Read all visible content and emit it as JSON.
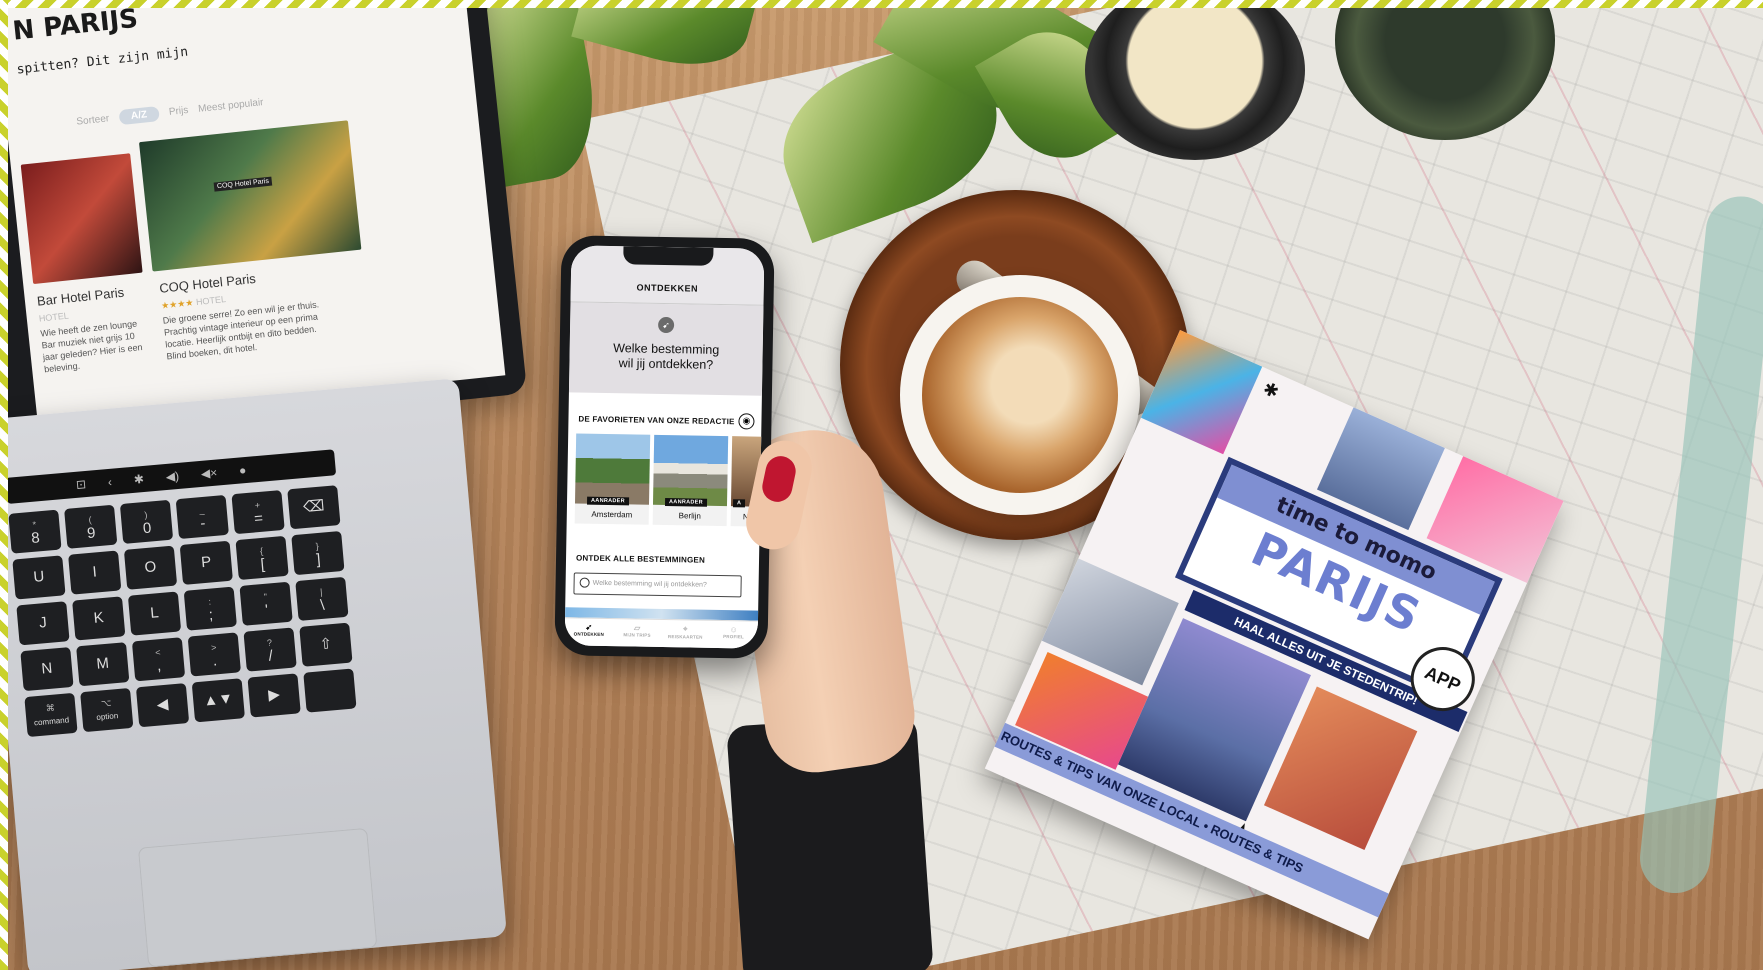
{
  "website": {
    "title": "N PARIJS",
    "subtitle": "spitten? Dit zijn mijn",
    "sort_label": "Sorteer",
    "sort_active": "A/Z",
    "sort_option_2": "Prijs",
    "sort_option_3": "Meest populair",
    "cards": [
      {
        "name": "Bar Hotel Paris",
        "tag": "HOTEL",
        "description": "Wie heeft de zen lounge Bar muziek niet grijs 10 jaar geleden? Hier is een beleving."
      },
      {
        "name": "COQ Hotel Paris",
        "stars": "★★★★",
        "tag": "HOTEL",
        "description": "Die groene serre! Zo een wil je er thuis. Prachtig vintage interieur op een prima locatie. Heerlijk ontbijt en dito bedden. Blind boeken, dit hotel."
      }
    ],
    "sign_text": "COQ Hotel Paris"
  },
  "keyboard": {
    "touchbar": [
      "⊡",
      "‹",
      "✱",
      "◀)",
      "◀×",
      "●"
    ],
    "keys": [
      {
        "top": "*",
        "main": "8"
      },
      {
        "top": "(",
        "main": "9"
      },
      {
        "top": ")",
        "main": "0"
      },
      {
        "top": "_",
        "main": "-"
      },
      {
        "top": "+",
        "main": "="
      },
      {
        "top": "",
        "main": "⌫"
      },
      {
        "top": "",
        "main": "U"
      },
      {
        "top": "",
        "main": "I"
      },
      {
        "top": "",
        "main": "O"
      },
      {
        "top": "",
        "main": "P"
      },
      {
        "top": "{",
        "main": "["
      },
      {
        "top": "}",
        "main": "]"
      },
      {
        "top": "",
        "main": "J"
      },
      {
        "top": "",
        "main": "K"
      },
      {
        "top": "",
        "main": "L"
      },
      {
        "top": ":",
        "main": ";"
      },
      {
        "top": "\"",
        "main": "'"
      },
      {
        "top": "|",
        "main": "\\"
      },
      {
        "top": "",
        "main": "N"
      },
      {
        "top": "",
        "main": "M"
      },
      {
        "top": "<",
        "main": ","
      },
      {
        "top": ">",
        "main": "."
      },
      {
        "top": "?",
        "main": "/"
      },
      {
        "top": "",
        "main": "⇧"
      },
      {
        "top": "⌘",
        "main": "command"
      },
      {
        "top": "⌥",
        "main": "option"
      },
      {
        "top": "",
        "main": "◀"
      },
      {
        "top": "",
        "main": "▲▼"
      },
      {
        "top": "",
        "main": "▶"
      },
      {
        "top": "",
        "main": ""
      }
    ]
  },
  "phone": {
    "topbar_title": "ONTDEKKEN",
    "hero_icon": "compass-icon",
    "hero_question_line1": "Welke bestemming",
    "hero_question_line2": "wil jij ontdekken?",
    "favorites_title": "DE FAVORIETEN VAN ONZE REDACTIE",
    "destinations": [
      {
        "name": "Amsterdam",
        "badge": "AANRADER"
      },
      {
        "name": "Berlijn",
        "badge": "AANRADER"
      },
      {
        "name": "N",
        "badge": "A"
      }
    ],
    "all_destinations_title": "ONTDEK ALLE BESTEMMINGEN",
    "search_placeholder": "Welke bestemming wil jij ontdekken?",
    "tabs": [
      {
        "label": "ONTDEKKEN",
        "icon": "compass-icon",
        "active": true
      },
      {
        "label": "MIJN TRIPS",
        "icon": "map-icon",
        "active": false
      },
      {
        "label": "REISKAARTEN",
        "icon": "pin-icon",
        "active": false
      },
      {
        "label": "PROFIEL",
        "icon": "person-icon",
        "active": false
      }
    ]
  },
  "book": {
    "brand": "time to momo",
    "city": "PARIJS",
    "tagline": "HAAL ALLES UIT JE STEDENTRIP!",
    "app_badge": "APP",
    "footer": "ROUTES & TIPS VAN ONZE LOCAL • ROUTES & TIPS",
    "star": "★",
    "asterisk": "✱"
  },
  "colors": {
    "stripe": "#c9d12c",
    "book_blue": "#6c7ed0",
    "nail_red": "#c01630"
  }
}
